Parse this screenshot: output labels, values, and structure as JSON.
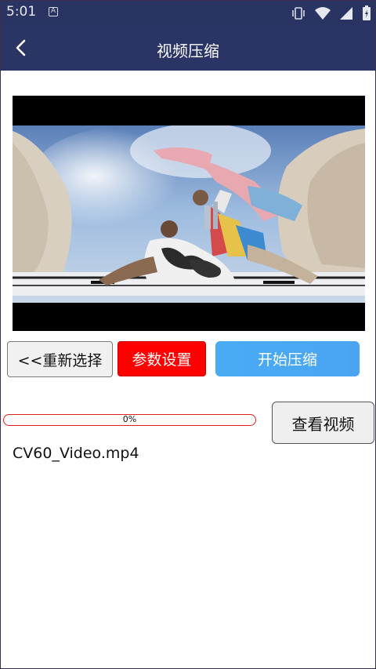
{
  "status_bar": {
    "time": "5:01",
    "notification_icon": "a-box-icon",
    "icons": [
      "vibrate-icon",
      "wifi-icon",
      "signal-icon",
      "battery-icon"
    ]
  },
  "app_bar": {
    "title": "视频压缩",
    "back_icon": "chevron-left-icon"
  },
  "video_preview": {
    "content": "360-degree beach video frame"
  },
  "actions": {
    "reselect_label": "<<重新选择",
    "params_label": "参数设置",
    "start_label": "开始压缩",
    "view_label": "查看视频"
  },
  "progress": {
    "value": 0,
    "text": "0%"
  },
  "file": {
    "name": "CV60_Video.mp4"
  },
  "colors": {
    "app_bar": "#2b3565",
    "params_button": "#ff0000",
    "start_button": "#49acf3",
    "progress_border": "#e02020"
  }
}
